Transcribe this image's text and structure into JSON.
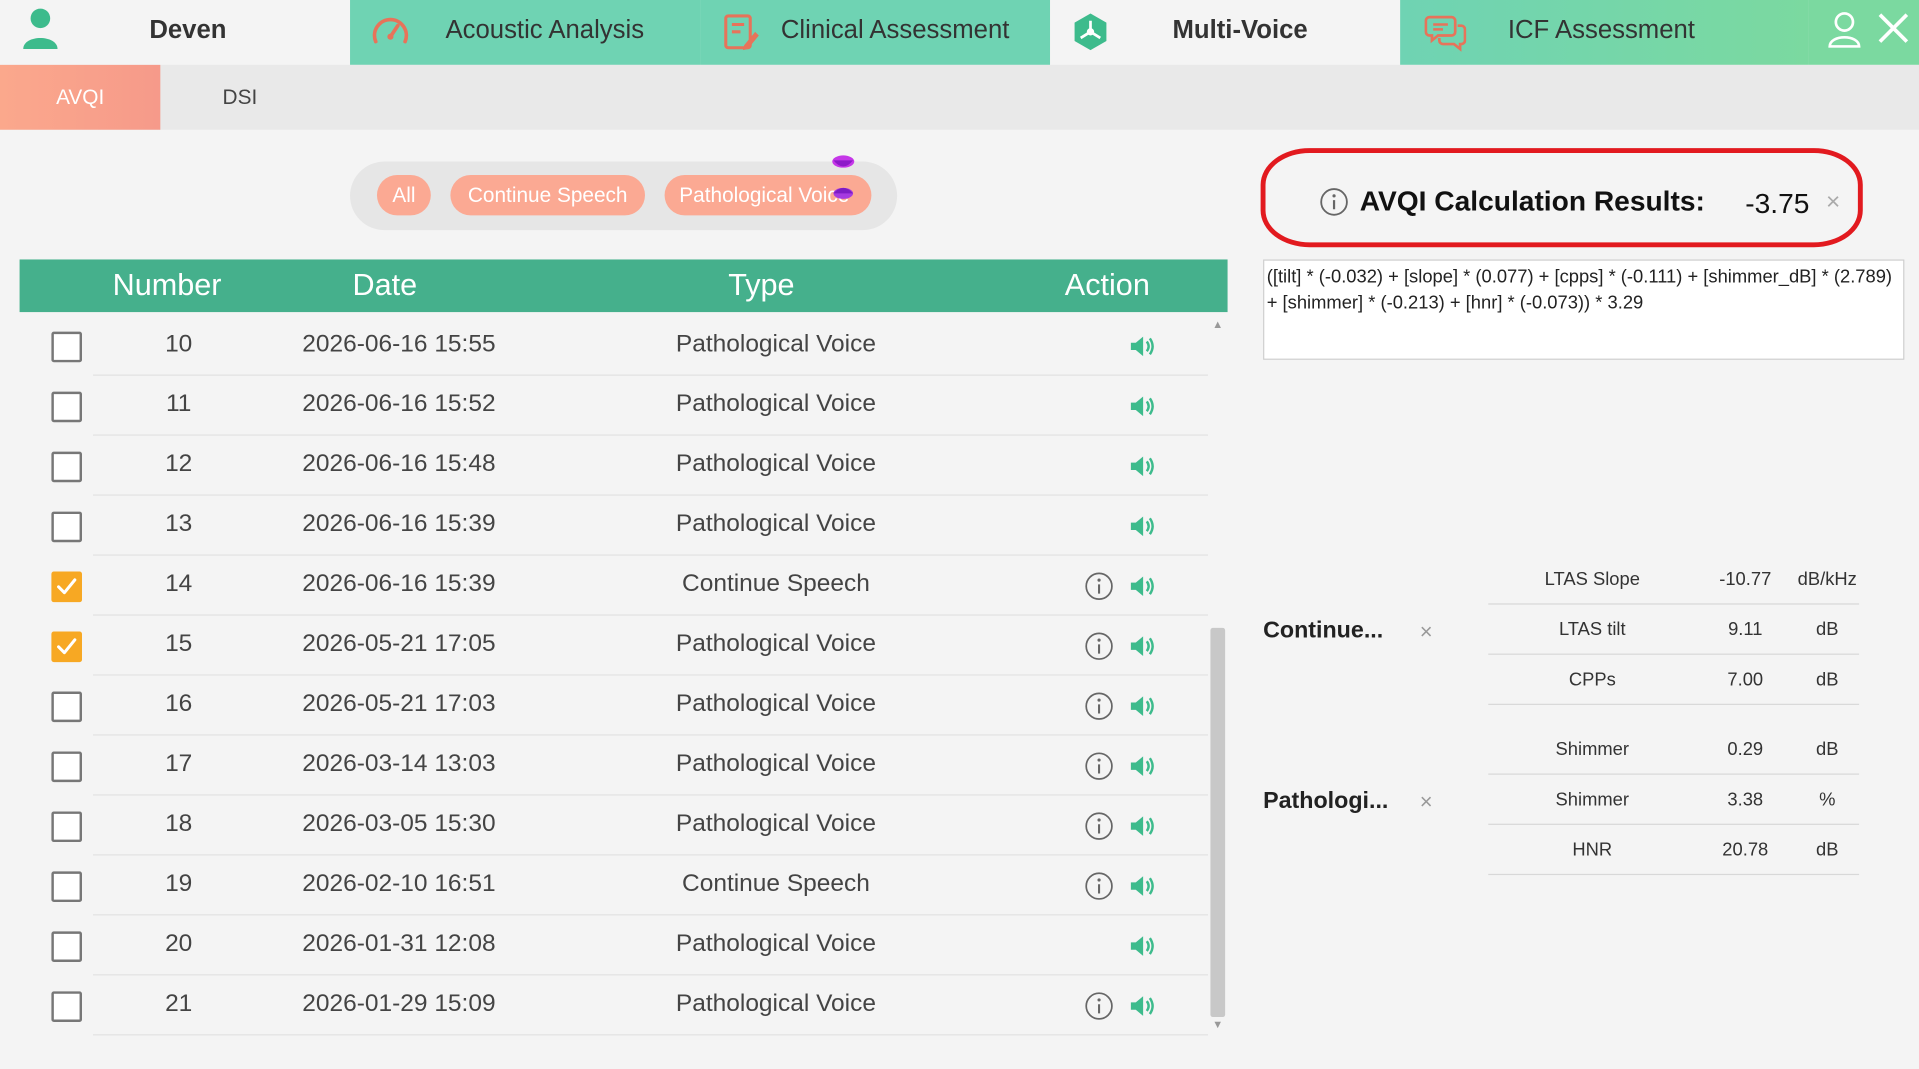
{
  "colors": {
    "nav_tab": "#6fd3b3",
    "table_header": "#45b08c",
    "pill": "#fba993",
    "avqi_tab": "#f69a8a",
    "checkbox_checked": "#f7a823",
    "result_outline": "#e21a1f",
    "sound_icon": "#3dbb8c"
  },
  "nav": {
    "user_name": "Deven",
    "tabs": [
      {
        "label": "Acoustic Analysis",
        "icon": "gauge-icon"
      },
      {
        "label": "Clinical Assessment",
        "icon": "clipboard-edit-icon"
      },
      {
        "label": "Multi-Voice",
        "icon": "hexagon-network-icon",
        "active": true
      },
      {
        "label": "ICF Assessment",
        "icon": "chat-bubbles-icon"
      }
    ]
  },
  "subtabs": [
    {
      "label": "AVQI",
      "active": true
    },
    {
      "label": "DSI",
      "active": false
    }
  ],
  "filters": {
    "all": "All",
    "continue_speech": "Continue Speech",
    "pathological_voice": "Pathological Voice"
  },
  "table": {
    "headers": {
      "number": "Number",
      "date": "Date",
      "type": "Type",
      "action": "Action"
    },
    "rows": [
      {
        "checked": false,
        "number": "10",
        "date": "2026-06-16 15:55",
        "type": "Pathological Voice",
        "info": false
      },
      {
        "checked": false,
        "number": "11",
        "date": "2026-06-16 15:52",
        "type": "Pathological Voice",
        "info": false
      },
      {
        "checked": false,
        "number": "12",
        "date": "2026-06-16 15:48",
        "type": "Pathological Voice",
        "info": false
      },
      {
        "checked": false,
        "number": "13",
        "date": "2026-06-16 15:39",
        "type": "Pathological Voice",
        "info": false
      },
      {
        "checked": true,
        "number": "14",
        "date": "2026-06-16 15:39",
        "type": "Continue Speech",
        "info": true
      },
      {
        "checked": true,
        "number": "15",
        "date": "2026-05-21 17:05",
        "type": "Pathological Voice",
        "info": true
      },
      {
        "checked": false,
        "number": "16",
        "date": "2026-05-21 17:03",
        "type": "Pathological Voice",
        "info": true
      },
      {
        "checked": false,
        "number": "17",
        "date": "2026-03-14 13:03",
        "type": "Pathological Voice",
        "info": true
      },
      {
        "checked": false,
        "number": "18",
        "date": "2026-03-05 15:30",
        "type": "Pathological Voice",
        "info": true
      },
      {
        "checked": false,
        "number": "19",
        "date": "2026-02-10 16:51",
        "type": "Continue Speech",
        "info": true
      },
      {
        "checked": false,
        "number": "20",
        "date": "2026-01-31 12:08",
        "type": "Pathological Voice",
        "info": false
      },
      {
        "checked": false,
        "number": "21",
        "date": "2026-01-29 15:09",
        "type": "Pathological Voice",
        "info": true
      }
    ]
  },
  "result": {
    "title": "AVQI Calculation Results:",
    "value": "-3.75",
    "close": "×",
    "formula": "([tilt] * (-0.032) + [slope] * (0.077) + [cpps] * (-0.111) + [shimmer_dB] * (2.789) + [shimmer] * (-0.213) + [hnr] * (-0.073)) * 3.29"
  },
  "groups": [
    {
      "label": "Continue...",
      "close": "×",
      "params": [
        {
          "name": "LTAS Slope",
          "value": "-10.77",
          "unit": "dB/kHz"
        },
        {
          "name": "LTAS tilt",
          "value": "9.11",
          "unit": "dB"
        },
        {
          "name": "CPPs",
          "value": "7.00",
          "unit": "dB"
        }
      ]
    },
    {
      "label": "Pathologi...",
      "close": "×",
      "params": [
        {
          "name": "Shimmer",
          "value": "0.29",
          "unit": "dB"
        },
        {
          "name": "Shimmer",
          "value": "3.38",
          "unit": "%"
        },
        {
          "name": "HNR",
          "value": "20.78",
          "unit": "dB"
        }
      ]
    }
  ]
}
